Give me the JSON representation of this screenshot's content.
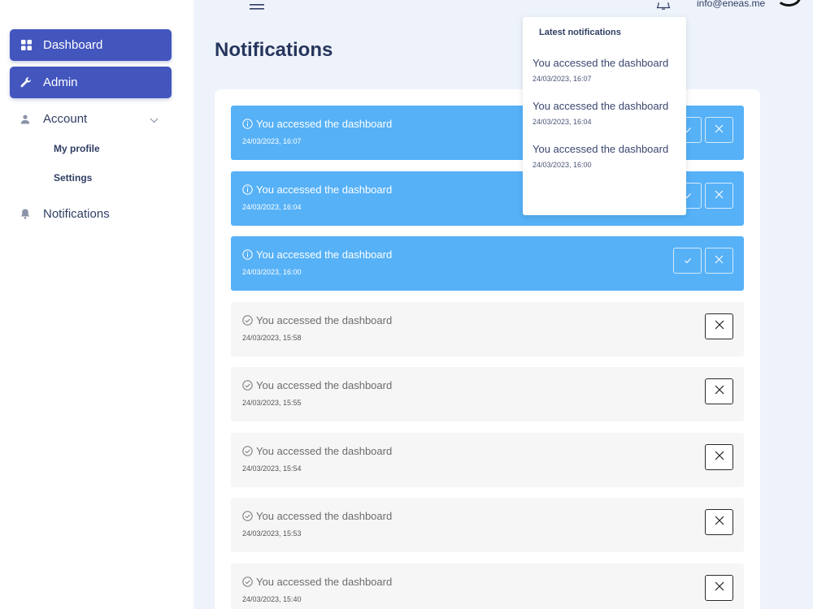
{
  "sidebar": {
    "dashboard": "Dashboard",
    "admin": "Admin",
    "account": "Account",
    "my_profile": "My profile",
    "settings": "Settings",
    "notifications": "Notifications"
  },
  "header": {
    "email": "info@eneas.me"
  },
  "page": {
    "title": "Notifications"
  },
  "notifications": [
    {
      "message": "You accessed the dashboard",
      "time": "24/03/2023, 16:07",
      "state": "unread"
    },
    {
      "message": "You accessed the dashboard",
      "time": "24/03/2023, 16:04",
      "state": "unread"
    },
    {
      "message": "You accessed the dashboard",
      "time": "24/03/2023, 16:00",
      "state": "unread"
    },
    {
      "message": "You accessed the dashboard",
      "time": "24/03/2023, 15:58",
      "state": "read"
    },
    {
      "message": "You accessed the dashboard",
      "time": "24/03/2023, 15:55",
      "state": "read"
    },
    {
      "message": "You accessed the dashboard",
      "time": "24/03/2023, 15:54",
      "state": "read"
    },
    {
      "message": "You accessed the dashboard",
      "time": "24/03/2023, 15:53",
      "state": "read"
    },
    {
      "message": "You accessed the dashboard",
      "time": "24/03/2023, 15:40",
      "state": "read"
    }
  ],
  "dropdown": {
    "title": "Latest notifications",
    "items": [
      {
        "message": "You accessed the dashboard",
        "time": "24/03/2023, 16:07"
      },
      {
        "message": "You accessed the dashboard",
        "time": "24/03/2023, 16:04"
      },
      {
        "message": "You accessed the dashboard",
        "time": "24/03/2023, 16:00"
      }
    ]
  },
  "colors": {
    "primary": "#4356be",
    "unread": "#56b1f7",
    "read": "#f6f6f6",
    "background": "#eef3fb"
  },
  "icons": {
    "dashboard": "grid-icon",
    "admin": "wrench-icon",
    "account": "user-icon",
    "notifications": "bell-icon",
    "unread": "info-circle-icon",
    "read": "check-circle-icon",
    "mark_read": "check-icon",
    "dismiss": "close-icon"
  }
}
